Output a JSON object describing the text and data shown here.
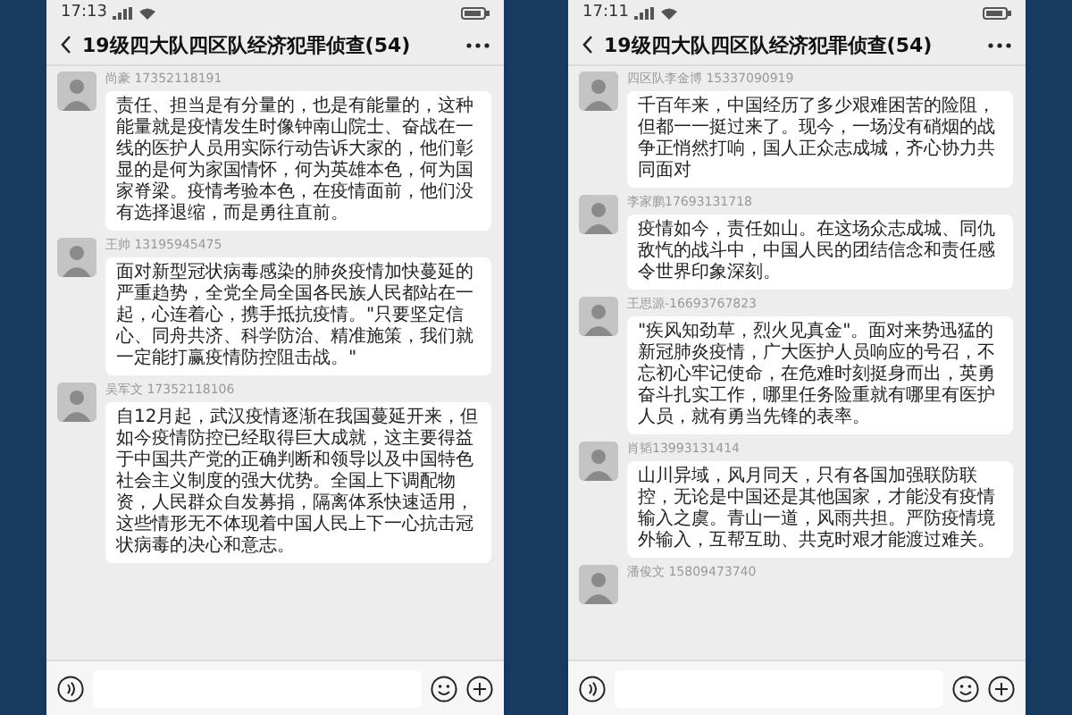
{
  "phones": [
    {
      "status_time": "17:13",
      "title": "19级四大队四区队经济犯罪侦查(54)",
      "messages": [
        {
          "sender": "尚豪 17352118191",
          "text": "责任、担当是有分量的，也是有能量的，这种能量就是疫情发生时像钟南山院士、奋战在一线的医护人员用实际行动告诉大家的，他们彰显的是何为家国情怀，何为英雄本色，何为国家脊梁。疫情考验本色，在疫情面前，他们没有选择退缩，而是勇往直前。"
        },
        {
          "sender": "王帅 13195945475",
          "text": "面对新型冠状病毒感染的肺炎疫情加快蔓延的严重趋势，全党全局全国各民族人民都站在一起，心连着心，携手抵抗疫情。\"只要坚定信心、同舟共济、科学防治、精准施策，我们就一定能打赢疫情防控阻击战。\""
        },
        {
          "sender": "吴军文 17352118106",
          "text": "自12月起，武汉疫情逐渐在我国蔓延开来，但如今疫情防控已经取得巨大成就，这主要得益于中国共产党的正确判断和领导以及中国特色社会主义制度的强大优势。全国上下调配物资，人民群众自发募捐，隔离体系快速适用，这些情形无不体现着中国人民上下一心抗击冠状病毒的决心和意志。"
        }
      ]
    },
    {
      "status_time": "17:11",
      "title": "19级四大队四区队经济犯罪侦查(54)",
      "messages": [
        {
          "sender": "四区队李金博 15337090919",
          "text": "千百年来，中国经历了多少艰难困苦的险阻，但都一一挺过来了。现今，一场没有硝烟的战争正悄然打响，国人正众志成城，齐心协力共同面对"
        },
        {
          "sender": "李家鹏17693131718",
          "text": "疫情如今，责任如山。在这场众志成城、同仇敌忾的战斗中，中国人民的团结信念和责任感令世界印象深刻。"
        },
        {
          "sender": "王思源-16693767823",
          "text": "\"疾风知劲草，烈火见真金\"。面对来势迅猛的新冠肺炎疫情，广大医护人员响应的号召，不忘初心牢记使命，在危难时刻挺身而出，英勇奋斗扎实工作，哪里任务险重就有哪里有医护人员，就有勇当先锋的表率。"
        },
        {
          "sender": "肖韬13993131414",
          "text": "山川异域，风月同天，只有各国加强联防联控，无论是中国还是其他国家，才能没有疫情输入之虞。青山一道，风雨共担。严防疫情境外输入，互帮互助、共克时艰才能渡过难关。"
        },
        {
          "sender": "潘俊文 15809473740"
        }
      ]
    }
  ]
}
